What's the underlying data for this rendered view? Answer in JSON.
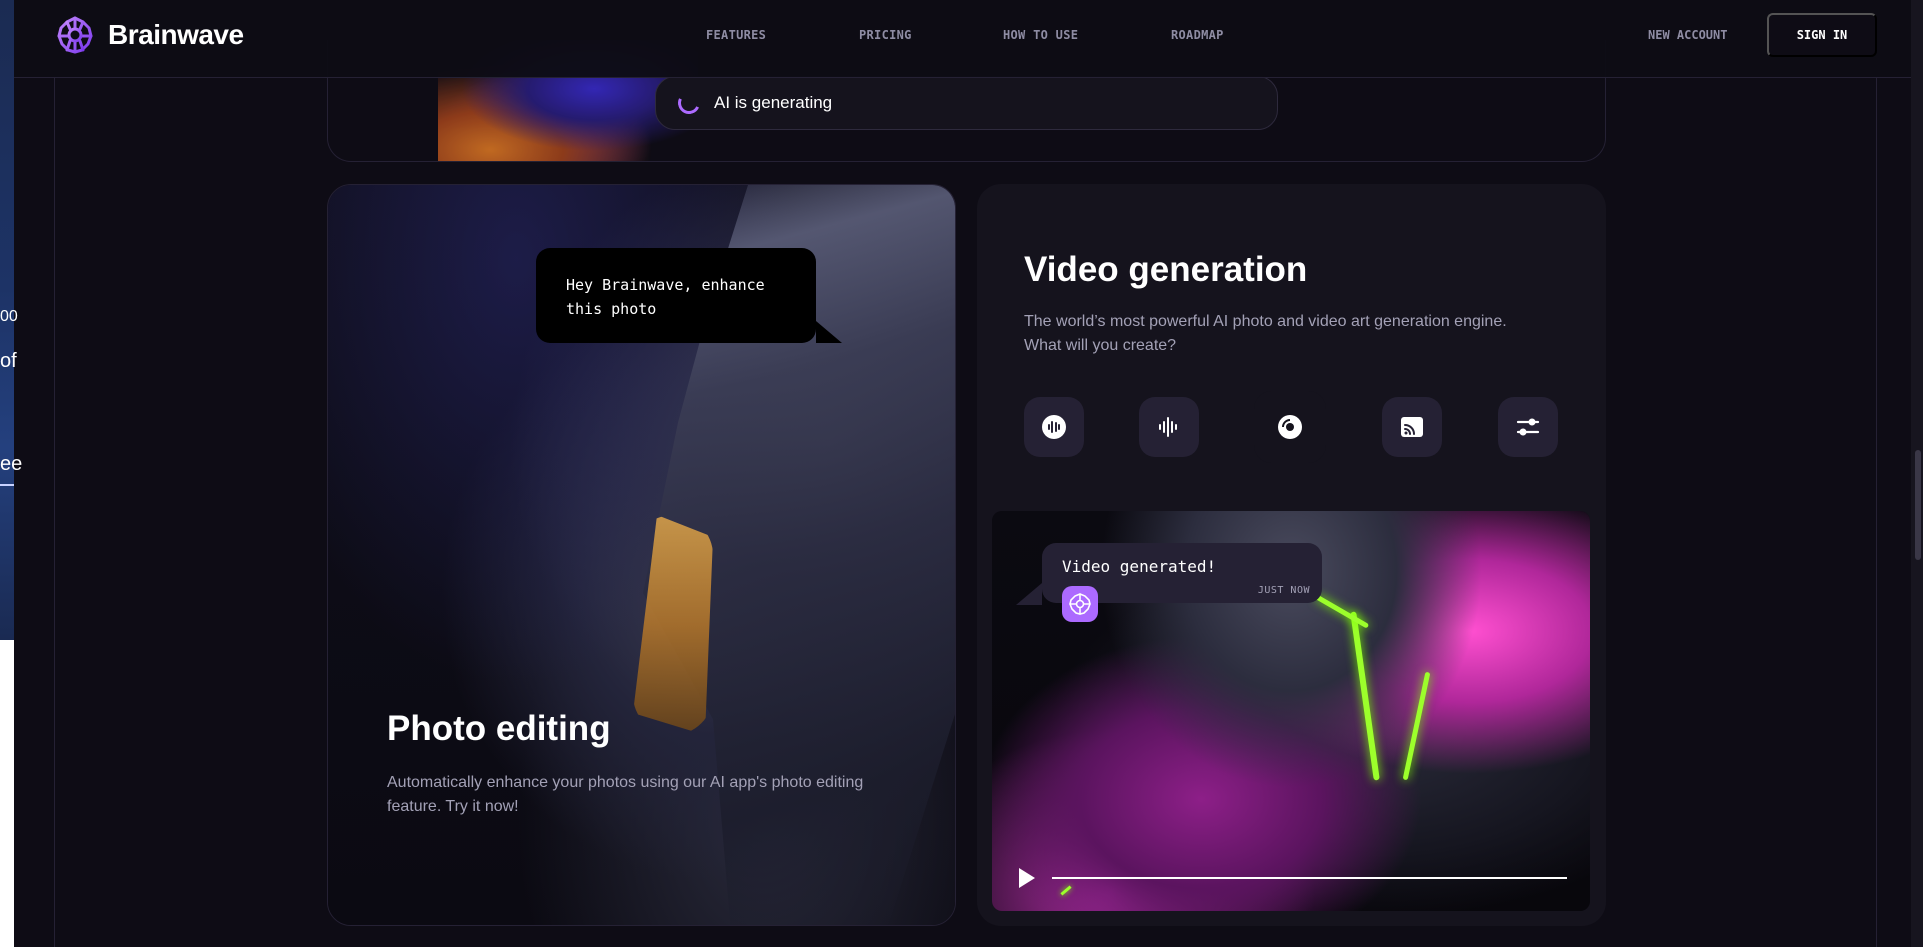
{
  "header": {
    "logo_text": "Brainwave",
    "nav": [
      "FEATURES",
      "PRICING",
      "HOW TO USE",
      "ROADMAP"
    ],
    "new_account": "NEW ACCOUNT",
    "sign_in": "SIGN IN"
  },
  "top_card": {
    "generating_text": "AI is generating"
  },
  "photo_card": {
    "bubble_text": "Hey Brainwave, enhance this photo",
    "title": "Photo editing",
    "description": "Automatically enhance your photos using our AI app's photo editing feature. Try it now!"
  },
  "video_card": {
    "title": "Video generation",
    "description": "The world’s most powerful AI photo and video art generation engine. What will you create?",
    "tools": [
      "audio-wave-icon",
      "soundwave-icon",
      "disc-icon",
      "cast-icon",
      "settings-sliders-icon"
    ],
    "active_tool_index": 2,
    "notification": {
      "text": "Video generated!",
      "time": "JUST NOW"
    },
    "player": {
      "progress_fraction": 0.0
    }
  },
  "left_strip": {
    "t1": "00",
    "t2": "of",
    "t3": "ee"
  },
  "colors": {
    "background": "#0e0c15",
    "card": "#15131d",
    "accent": "#ac6aff",
    "neon": "#9cff2b",
    "muted_text": "#a3a1b6"
  }
}
